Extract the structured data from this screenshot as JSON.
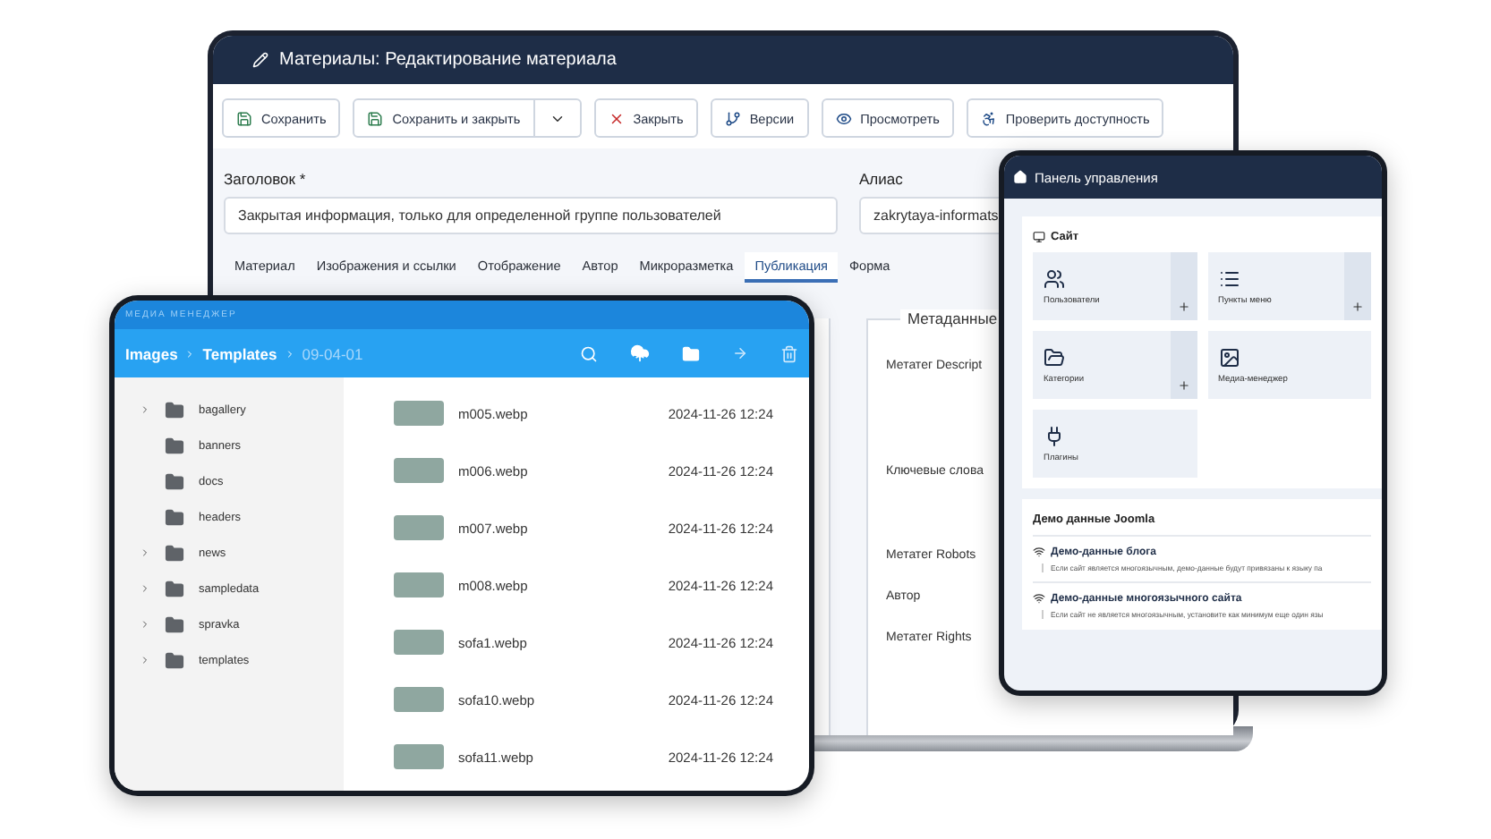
{
  "laptop": {
    "title": "Материалы: Редактирование материала",
    "toolbar": [
      {
        "label": "Сохранить",
        "kind": "save",
        "dropdown": false
      },
      {
        "label": "Сохранить и закрыть",
        "kind": "save",
        "dropdown": true
      },
      {
        "label": "Закрыть",
        "kind": "close",
        "dropdown": false
      },
      {
        "label": "Версии",
        "kind": "versions",
        "dropdown": false
      },
      {
        "label": "Просмотреть",
        "kind": "preview",
        "dropdown": false
      },
      {
        "label": "Проверить доступность",
        "kind": "accessibility",
        "dropdown": false
      }
    ],
    "title_field": {
      "label": "Заголовок *",
      "value": "Закрытая информация, только для определенной группе пользователей"
    },
    "alias_field": {
      "label": "Алиас",
      "value": "zakrytaya-informats"
    },
    "tabs": [
      {
        "label": "Материал",
        "selected": false
      },
      {
        "label": "Изображения и ссылки",
        "selected": false
      },
      {
        "label": "Отображение",
        "selected": false
      },
      {
        "label": "Автор",
        "selected": false
      },
      {
        "label": "Микроразметка",
        "selected": false
      },
      {
        "label": "Публикация",
        "selected": true
      },
      {
        "label": "Форма",
        "selected": false
      }
    ],
    "metadata": {
      "legend": "Метаданные",
      "fields": [
        "Метатег Descript",
        "Ключевые слова",
        "Метатег Robots",
        "Автор",
        "Метатег Rights"
      ]
    }
  },
  "media_manager": {
    "caption": "МЕДИА МЕНЕДЖЕР",
    "breadcrumb": [
      "Images",
      "Templates",
      "09-04-01"
    ],
    "folders": [
      {
        "name": "bagallery",
        "expandable": true
      },
      {
        "name": "banners",
        "expandable": false
      },
      {
        "name": "docs",
        "expandable": false
      },
      {
        "name": "headers",
        "expandable": false
      },
      {
        "name": "news",
        "expandable": true
      },
      {
        "name": "sampledata",
        "expandable": true
      },
      {
        "name": "spravka",
        "expandable": true
      },
      {
        "name": "templates",
        "expandable": true
      }
    ],
    "files": [
      {
        "name": "m005.webp",
        "date": "2024-11-26 12:24"
      },
      {
        "name": "m006.webp",
        "date": "2024-11-26 12:24"
      },
      {
        "name": "m007.webp",
        "date": "2024-11-26 12:24"
      },
      {
        "name": "m008.webp",
        "date": "2024-11-26 12:24"
      },
      {
        "name": "sofa1.webp",
        "date": "2024-11-26 12:24"
      },
      {
        "name": "sofa10.webp",
        "date": "2024-11-26 12:24"
      },
      {
        "name": "sofa11.webp",
        "date": "2024-11-26 12:24"
      }
    ]
  },
  "control_panel": {
    "title": "Панель управления",
    "site": {
      "heading": "Сайт",
      "tiles": [
        {
          "label": "Пользователи",
          "kind": "users",
          "add": true
        },
        {
          "label": "Пункты меню",
          "kind": "menu",
          "add": true
        },
        {
          "label": "Категории",
          "kind": "categories",
          "add": true
        },
        {
          "label": "Медиа-менеджер",
          "kind": "media",
          "add": false
        },
        {
          "label": "Плагины",
          "kind": "plugins",
          "add": false
        }
      ]
    },
    "sample_data": {
      "heading": "Демо данные Joomla",
      "items": [
        {
          "title": "Демо-данные блога",
          "description": "Если сайт является многоязычным, демо-данные будут привязаны к языку па"
        },
        {
          "title": "Демо-данные многоязычного сайта",
          "description": "Если сайт не является многоязычным, установите как минимум еще один язы"
        }
      ]
    }
  }
}
